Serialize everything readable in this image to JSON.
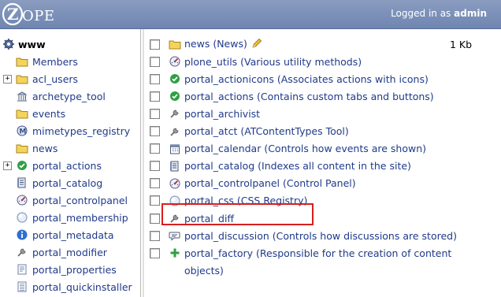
{
  "header": {
    "logo_text": "ZOPE",
    "logged_in_prefix": "Logged in as",
    "user": "admin",
    "bg_color": "#7a8fb8"
  },
  "nav": {
    "root": {
      "label": "www",
      "icon": "gear-icon"
    },
    "items": [
      {
        "label": "Members",
        "icon": "folder-icon",
        "expandable": false
      },
      {
        "label": "acl_users",
        "icon": "folder-icon",
        "expandable": true
      },
      {
        "label": "archetype_tool",
        "icon": "building-icon",
        "expandable": false
      },
      {
        "label": "events",
        "icon": "folder-icon",
        "expandable": false
      },
      {
        "label": "mimetypes_registry",
        "icon": "mimetypes-icon",
        "expandable": false
      },
      {
        "label": "news",
        "icon": "folder-icon",
        "expandable": false
      },
      {
        "label": "portal_actions",
        "icon": "checkmark-icon",
        "expandable": true
      },
      {
        "label": "portal_catalog",
        "icon": "catalog-icon",
        "expandable": false
      },
      {
        "label": "portal_controlpanel",
        "icon": "controlpanel-icon",
        "expandable": false
      },
      {
        "label": "portal_membership",
        "icon": "membership-icon",
        "expandable": false
      },
      {
        "label": "portal_metadata",
        "icon": "info-icon",
        "expandable": false
      },
      {
        "label": "portal_modifier",
        "icon": "wrench-icon",
        "expandable": false
      },
      {
        "label": "portal_properties",
        "icon": "properties-icon",
        "expandable": false
      },
      {
        "label": "portal_quickinstaller",
        "icon": "installer-icon",
        "expandable": false
      }
    ]
  },
  "list": {
    "rows": [
      {
        "label": "news (News)",
        "icon": "folder-icon",
        "size": "1 Kb",
        "editable": true
      },
      {
        "label": "plone_utils (Various utility methods)",
        "icon": "utils-icon"
      },
      {
        "label": "portal_actionicons (Associates actions with icons)",
        "icon": "checkmark-icon"
      },
      {
        "label": "portal_actions (Contains custom tabs and buttons)",
        "icon": "checkmark-icon"
      },
      {
        "label": "portal_archivist",
        "icon": "wrench-icon"
      },
      {
        "label": "portal_atct (ATContentTypes Tool)",
        "icon": "wrench-icon"
      },
      {
        "label": "portal_calendar (Controls how events are shown)",
        "icon": "calendar-icon"
      },
      {
        "label": "portal_catalog (Indexes all content in the site)",
        "icon": "catalog-icon"
      },
      {
        "label": "portal_controlpanel (Control Panel)",
        "icon": "controlpanel-icon"
      },
      {
        "label": "portal_css (CSS Registry)",
        "icon": "css-registry-icon",
        "highlighted": true
      },
      {
        "label": "portal_diff",
        "icon": "wrench-icon"
      },
      {
        "label": "portal_discussion (Controls how discussions are stored)",
        "icon": "discussion-icon"
      },
      {
        "label": "portal_factory (Responsible for the creation of content",
        "icon": "plus-icon",
        "continuation": "objects)"
      }
    ]
  },
  "colors": {
    "link": "#1f3a8a",
    "highlight": "#d81e1e"
  }
}
